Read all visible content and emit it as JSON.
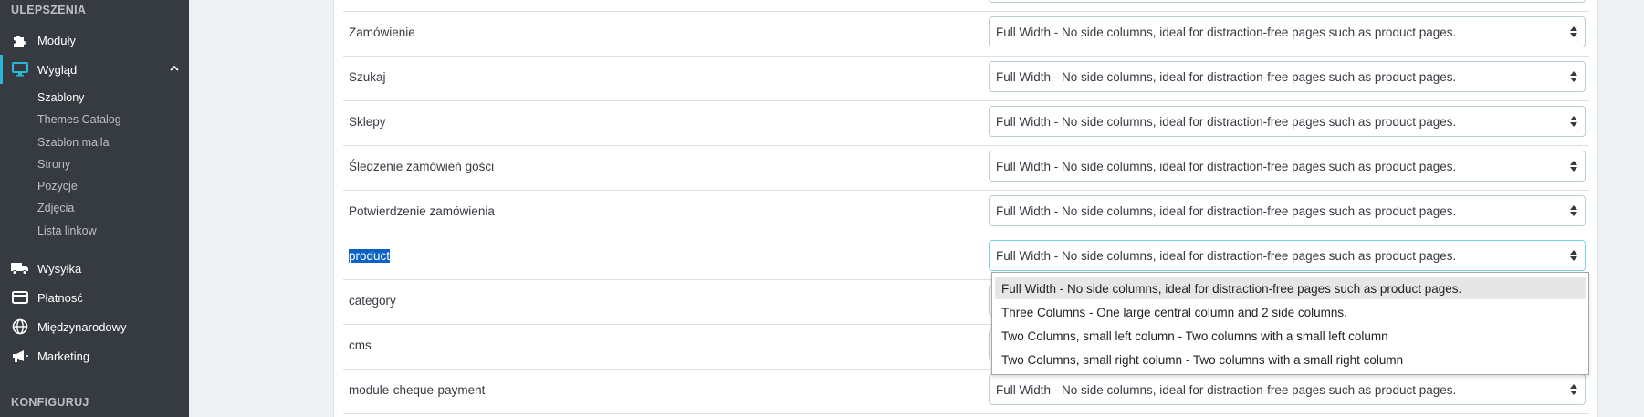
{
  "sidebar": {
    "section_improve": "ULEPSZENIA",
    "section_configure": "KONFIGURUJ",
    "modules": {
      "label": "Moduły",
      "icon": "puzzle-icon"
    },
    "appearance": {
      "label": "Wygląd",
      "icon": "monitor-icon"
    },
    "submenu": [
      "Szablony",
      "Themes Catalog",
      "Szablon maila",
      "Strony",
      "Pozycje",
      "Zdjęcia",
      "Lista linkow"
    ],
    "shipping": {
      "label": "Wysyłka",
      "icon": "truck-icon"
    },
    "payment": {
      "label": "Płatnosć",
      "icon": "card-icon"
    },
    "international": {
      "label": "Międzynarodowy",
      "icon": "globe-icon"
    },
    "marketing": {
      "label": "Marketing",
      "icon": "megaphone-icon"
    }
  },
  "rows": [
    {
      "label": "Zamówienie",
      "value": "Full Width - No side columns, ideal for distraction-free pages such as product pages."
    },
    {
      "label": "Szukaj",
      "value": "Full Width - No side columns, ideal for distraction-free pages such as product pages."
    },
    {
      "label": "Sklepy",
      "value": "Full Width - No side columns, ideal for distraction-free pages such as product pages."
    },
    {
      "label": "Śledzenie zamówień gości",
      "value": "Full Width - No side columns, ideal for distraction-free pages such as product pages."
    },
    {
      "label": "Potwierdzenie zamówienia",
      "value": "Full Width - No side columns, ideal for distraction-free pages such as product pages."
    },
    {
      "label": "product",
      "value": "Full Width - No side columns, ideal for distraction-free pages such as product pages."
    },
    {
      "label": "category",
      "value": ""
    },
    {
      "label": "cms",
      "value": ""
    },
    {
      "label": "module-cheque-payment",
      "value": "Full Width - No side columns, ideal for distraction-free pages such as product pages."
    }
  ],
  "dropdown_options": [
    "Full Width - No side columns, ideal for distraction-free pages such as product pages.",
    "Three Columns - One large central column and 2 side columns.",
    "Two Columns, small left column - Two columns with a small left column",
    "Two Columns, small right column - Two columns with a small right column"
  ],
  "colors": {
    "sidebar_bg": "#363a41",
    "accent": "#25b9d7",
    "text_selection": "#0a62c5"
  }
}
